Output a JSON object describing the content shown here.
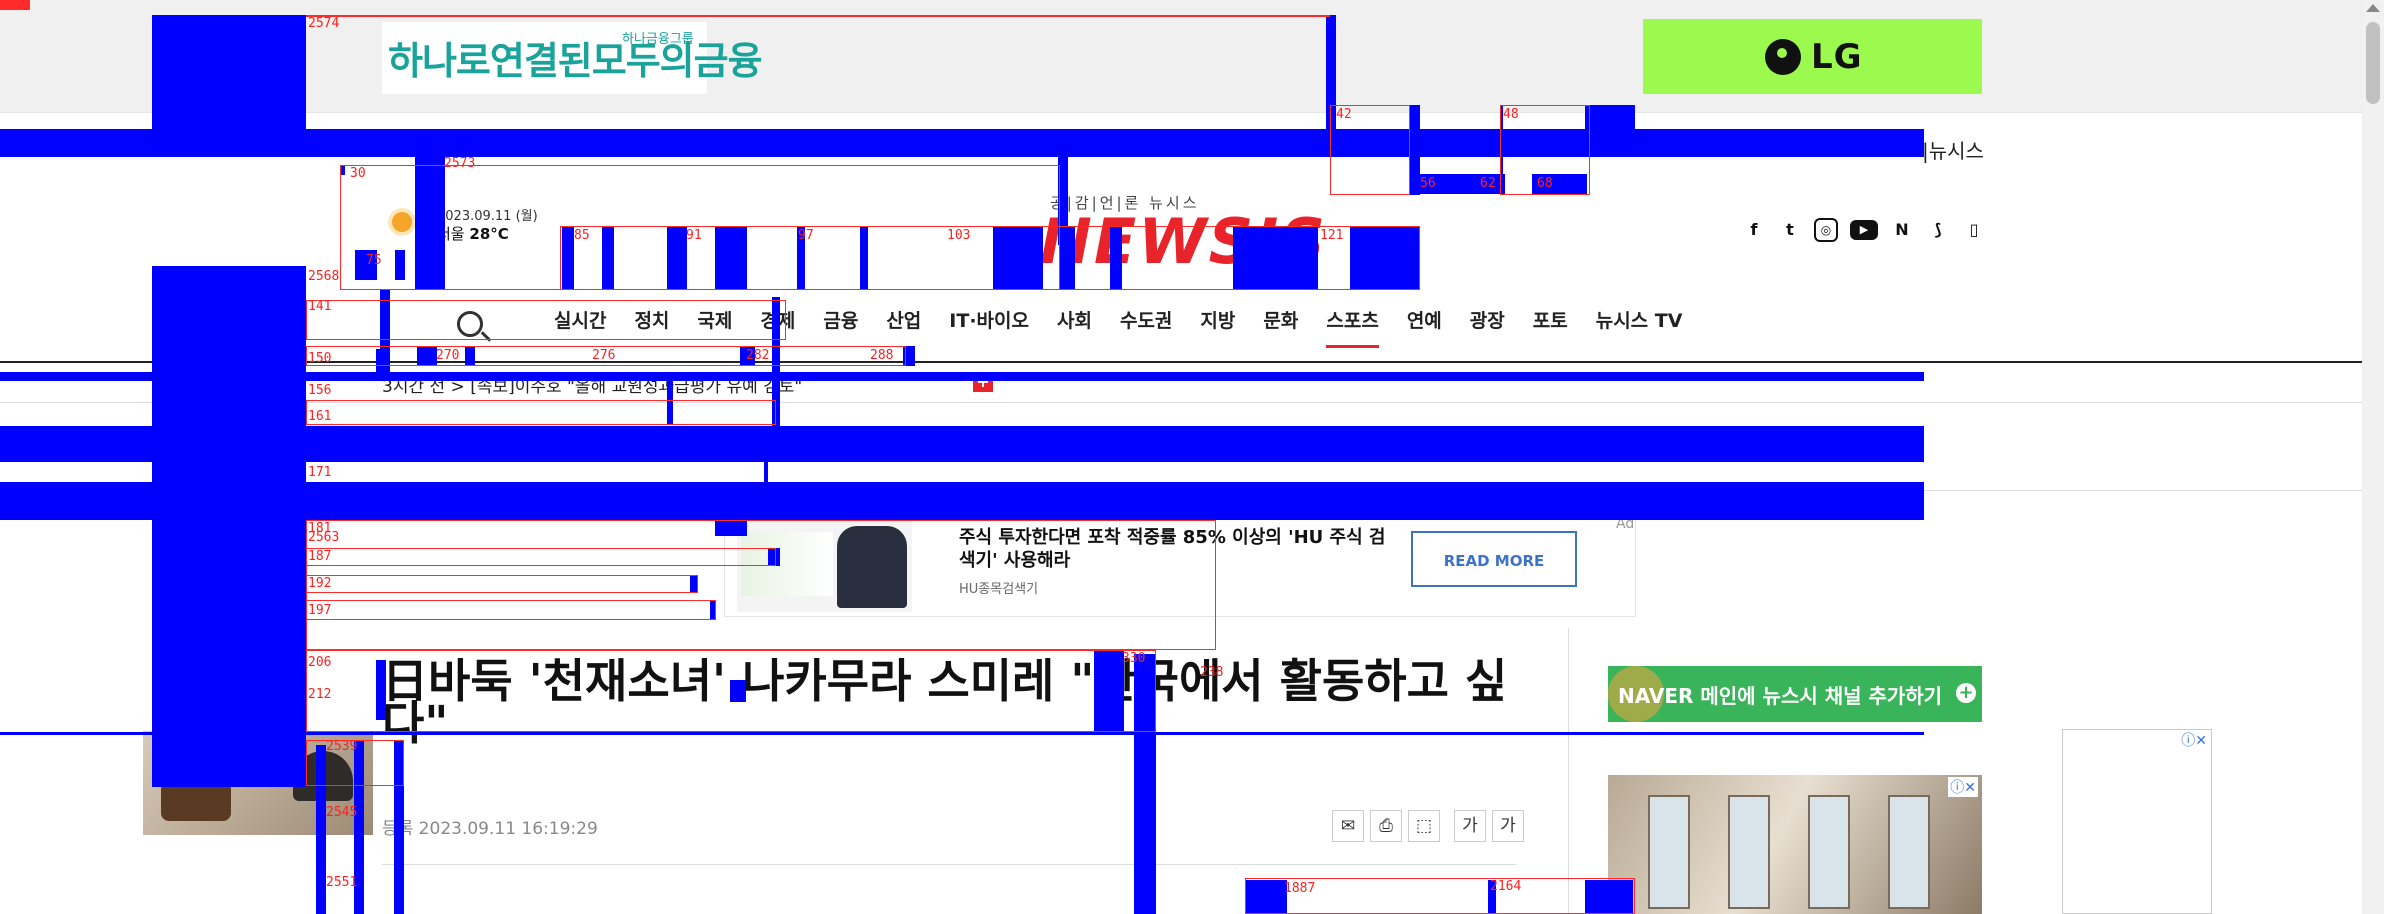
{
  "ads": {
    "hana_main": "하나로연결된모두의금융",
    "hana_small": "하나금융그룹",
    "lg_brand": "LG",
    "stock_title": "주식 투자한다면 포착 적중률 85% 이상의 'HU 주식 검색기' 사용해라",
    "stock_source": "HU종목검색기",
    "stock_button": "READ MORE",
    "ad_marker": "Ad",
    "naver_brand": "NAVER",
    "naver_text": "메인에 뉴스시 채널 추가하기",
    "adchoice": "ⓘ✕"
  },
  "header": {
    "newsis_link": "|뉴시스",
    "weather_date": "2023.09.11 (월)",
    "weather_city": "서울",
    "weather_temp": "28°C",
    "slogan": "공|감|언|론 뉴시스",
    "logo": "NEWSIS",
    "social": [
      "f",
      "t",
      "◎",
      "▶",
      "N",
      "⟆",
      "▯"
    ]
  },
  "nav": {
    "items": [
      "실시간",
      "정치",
      "국제",
      "경제",
      "금융",
      "산업",
      "IT·바이오",
      "사회",
      "수도권",
      "지방",
      "문화",
      "스포츠",
      "연예",
      "광장",
      "포토",
      "뉴시스 TV"
    ],
    "active_index": 11
  },
  "ticker": {
    "text": "3시간 전 > [속보]이주호 \"올해 교원성과급평가 유예 검토\"",
    "plus": "+"
  },
  "article": {
    "headline": "日바둑 '천재소녀' 나카무라 스미레 \"한국에서 활동하고 싶다\"",
    "date": "등록 2023.09.11 16:19:29",
    "tools": [
      "✉",
      "⎙",
      "⬚",
      "가",
      "가"
    ]
  },
  "debug_labels": [
    "2574",
    "42",
    "48",
    "2573",
    "30",
    "56",
    "62",
    "68",
    "75",
    "2568",
    "85",
    "91",
    "97",
    "103",
    "121",
    "141",
    "150",
    "270",
    "276",
    "282",
    "288",
    "156",
    "161",
    "171",
    "181",
    "2563",
    "187",
    "192",
    "197",
    "206",
    "212",
    "330",
    "238",
    "1887",
    "2164",
    "2551",
    "2545",
    "2539"
  ],
  "colors": {
    "overlay_blue": "#0000ff",
    "overlay_red": "#ff2a2a",
    "brand_red": "#e8232a",
    "lg_green": "#9cf94d",
    "naver_green": "#3ab45a"
  }
}
